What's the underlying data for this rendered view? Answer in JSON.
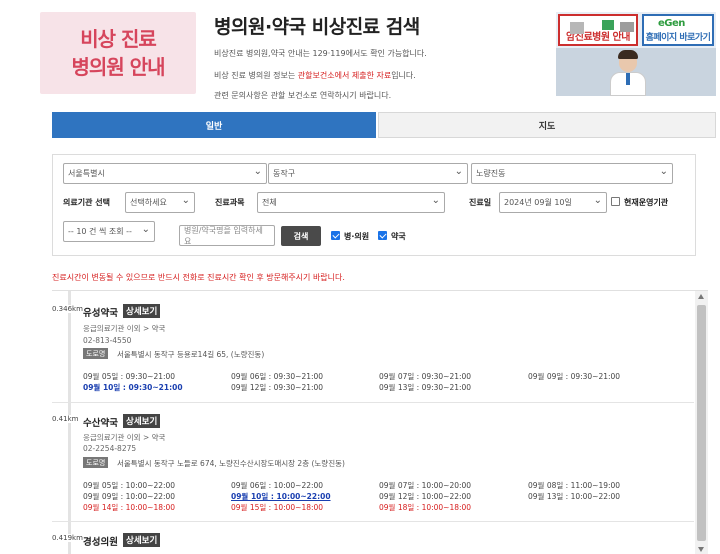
{
  "header": {
    "logo_line1": "비상 진료",
    "logo_line2": "병의원 안내",
    "title": "병의원·약국 비상진료 검색",
    "desc1": "비상진료 병의원,약국 안내는 129·119에서도 확인 가능합니다.",
    "desc2_pre": "비상 진료 병의원 정보는 ",
    "desc2_red": "관할보건소에서 제출한 자료",
    "desc2_post": "입니다.",
    "desc3": "관련 문의사항은 관할 보건소로 연락하시기 바랍니다.",
    "side_left": "암진료병원 안내",
    "side_right": "홈페이지 바로가기",
    "side_logo_text": "eGen"
  },
  "tabs": [
    {
      "label": "일반",
      "active": true
    },
    {
      "label": "지도",
      "active": false
    }
  ],
  "search": {
    "city": "서울특별시",
    "district": "동작구",
    "dong": "노량진동",
    "org_label": "의료기관 선택",
    "org_value": "선택하세요",
    "dept_label": "진료과목",
    "dept_value": "전체",
    "date_label": "진료일",
    "date_value": "2024년 09월 10일",
    "open_now_label": "현재운영기관",
    "page_size": "-- 10 건 씩 조회 --",
    "name_placeholder": "병원/약국명을 입력하세요",
    "search_button": "검색",
    "hospital_label": "병·의원",
    "pharmacy_label": "약국"
  },
  "notice": "진료시간이 변동될 수 있으므로 반드시 전화로 진료시간 확인 후 방문해주시기 바랍니다.",
  "detail_label": "상세보기",
  "address_badge": "도로명",
  "results": [
    {
      "distance": "0.346km",
      "name": "유성약국",
      "type": "응급의료기관 이외 > 약국",
      "phone": "02-813-4550",
      "address": "서울특별시 동작구 등용로14길 65, (노량진동)",
      "hours": [
        "09월 05일 : 09:30~21:00",
        "09월 06일 : 09:30~21:00",
        "09월 07일 : 09:30~21:00",
        "09월 09일 : 09:30~21:00",
        "09월 10일 : 09:30~21:00",
        "09월 12일 : 09:30~21:00",
        "09월 13일 : 09:30~21:00"
      ]
    },
    {
      "distance": "0.41km",
      "name": "수산약국",
      "type": "응급의료기관 이외 > 약국",
      "phone": "02-2254-8275",
      "address": "서울특별시 동작구 노들로 674, 노량진수산시장도매시장 2층 (노량진동)",
      "hours": [
        "09월 05일 : 10:00~22:00",
        "09월 06일 : 10:00~22:00",
        "09월 07일 : 10:00~20:00",
        "09월 08일 : 11:00~19:00",
        "09월 09일 : 10:00~22:00",
        "09월 10일 : 10:00~22:00",
        "09월 12일 : 10:00~22:00",
        "09월 13일 : 10:00~22:00",
        "09월 14일 : 10:00~18:00",
        "09월 15일 : 10:00~18:00",
        "09월 18일 : 10:00~18:00"
      ]
    },
    {
      "distance": "0.419km",
      "name": "경성의원"
    }
  ],
  "colors": {
    "accent_blue": "#2f74c0",
    "notice_red": "#d61e1e",
    "logo_pink": "#d6455c"
  }
}
